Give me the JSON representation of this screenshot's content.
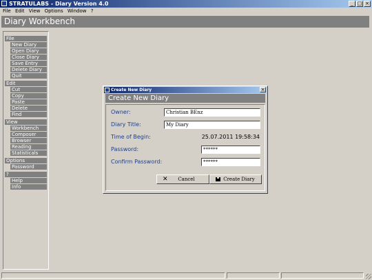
{
  "window": {
    "title": "STRATULABS - Diary Version 4.0",
    "minimize": "_",
    "maximize": "□",
    "close": "×"
  },
  "menubar": [
    "File",
    "Edit",
    "View",
    "Options",
    "Window",
    "?"
  ],
  "workbench_title": "Diary Workbench",
  "sidebar": {
    "file": {
      "header": "File",
      "items": [
        "New Diary",
        "Open Diary",
        "Close Diary",
        "Save Entry",
        "Delete Diary",
        "Quit"
      ]
    },
    "edit": {
      "header": "Edit",
      "items": [
        "Cut",
        "Copy",
        "Paste",
        "Delete",
        "Find"
      ]
    },
    "view": {
      "header": "View",
      "items": [
        "Workbench",
        "Composer",
        "Browser",
        "Reading",
        "Statisticals"
      ]
    },
    "options": {
      "header": "Options",
      "items": [
        "Password"
      ]
    },
    "help": {
      "header": "?",
      "items": [
        "Help",
        "Info"
      ]
    }
  },
  "dialog": {
    "title": "Create New Diary",
    "close": "×",
    "banner": "Create New Diary",
    "owner_label": "Owner:",
    "owner_value": "Christian BEnz",
    "diary_title_label": "Diary Title:",
    "diary_title_value": "My Diary",
    "time_label": "Time of Begin:",
    "time_value": "25.07.2011 19:58:34",
    "password_label": "Password:",
    "password_value": "******",
    "confirm_label": "Confirm Password:",
    "confirm_value": "******",
    "cancel_icon": "✕",
    "cancel_label": "Cancel",
    "create_label": "Create Diary"
  },
  "colors": {
    "accent": "#1b3f8b",
    "panel": "#808080",
    "background": "#d4d0c8"
  }
}
